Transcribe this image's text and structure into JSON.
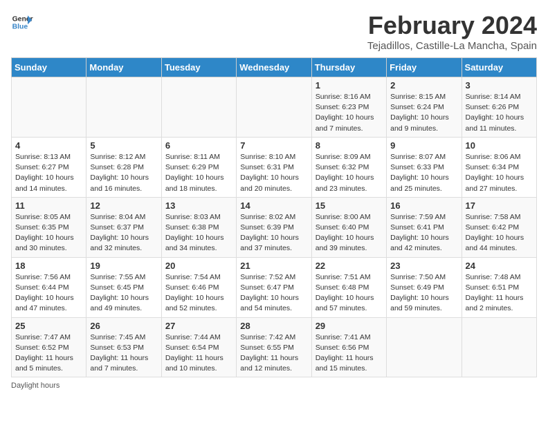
{
  "header": {
    "logo_line1": "General",
    "logo_line2": "Blue",
    "month": "February 2024",
    "location": "Tejadillos, Castille-La Mancha, Spain"
  },
  "columns": [
    "Sunday",
    "Monday",
    "Tuesday",
    "Wednesday",
    "Thursday",
    "Friday",
    "Saturday"
  ],
  "weeks": [
    [
      {
        "day": "",
        "info": ""
      },
      {
        "day": "",
        "info": ""
      },
      {
        "day": "",
        "info": ""
      },
      {
        "day": "",
        "info": ""
      },
      {
        "day": "1",
        "info": "Sunrise: 8:16 AM\nSunset: 6:23 PM\nDaylight: 10 hours\nand 7 minutes."
      },
      {
        "day": "2",
        "info": "Sunrise: 8:15 AM\nSunset: 6:24 PM\nDaylight: 10 hours\nand 9 minutes."
      },
      {
        "day": "3",
        "info": "Sunrise: 8:14 AM\nSunset: 6:26 PM\nDaylight: 10 hours\nand 11 minutes."
      }
    ],
    [
      {
        "day": "4",
        "info": "Sunrise: 8:13 AM\nSunset: 6:27 PM\nDaylight: 10 hours\nand 14 minutes."
      },
      {
        "day": "5",
        "info": "Sunrise: 8:12 AM\nSunset: 6:28 PM\nDaylight: 10 hours\nand 16 minutes."
      },
      {
        "day": "6",
        "info": "Sunrise: 8:11 AM\nSunset: 6:29 PM\nDaylight: 10 hours\nand 18 minutes."
      },
      {
        "day": "7",
        "info": "Sunrise: 8:10 AM\nSunset: 6:31 PM\nDaylight: 10 hours\nand 20 minutes."
      },
      {
        "day": "8",
        "info": "Sunrise: 8:09 AM\nSunset: 6:32 PM\nDaylight: 10 hours\nand 23 minutes."
      },
      {
        "day": "9",
        "info": "Sunrise: 8:07 AM\nSunset: 6:33 PM\nDaylight: 10 hours\nand 25 minutes."
      },
      {
        "day": "10",
        "info": "Sunrise: 8:06 AM\nSunset: 6:34 PM\nDaylight: 10 hours\nand 27 minutes."
      }
    ],
    [
      {
        "day": "11",
        "info": "Sunrise: 8:05 AM\nSunset: 6:35 PM\nDaylight: 10 hours\nand 30 minutes."
      },
      {
        "day": "12",
        "info": "Sunrise: 8:04 AM\nSunset: 6:37 PM\nDaylight: 10 hours\nand 32 minutes."
      },
      {
        "day": "13",
        "info": "Sunrise: 8:03 AM\nSunset: 6:38 PM\nDaylight: 10 hours\nand 34 minutes."
      },
      {
        "day": "14",
        "info": "Sunrise: 8:02 AM\nSunset: 6:39 PM\nDaylight: 10 hours\nand 37 minutes."
      },
      {
        "day": "15",
        "info": "Sunrise: 8:00 AM\nSunset: 6:40 PM\nDaylight: 10 hours\nand 39 minutes."
      },
      {
        "day": "16",
        "info": "Sunrise: 7:59 AM\nSunset: 6:41 PM\nDaylight: 10 hours\nand 42 minutes."
      },
      {
        "day": "17",
        "info": "Sunrise: 7:58 AM\nSunset: 6:42 PM\nDaylight: 10 hours\nand 44 minutes."
      }
    ],
    [
      {
        "day": "18",
        "info": "Sunrise: 7:56 AM\nSunset: 6:44 PM\nDaylight: 10 hours\nand 47 minutes."
      },
      {
        "day": "19",
        "info": "Sunrise: 7:55 AM\nSunset: 6:45 PM\nDaylight: 10 hours\nand 49 minutes."
      },
      {
        "day": "20",
        "info": "Sunrise: 7:54 AM\nSunset: 6:46 PM\nDaylight: 10 hours\nand 52 minutes."
      },
      {
        "day": "21",
        "info": "Sunrise: 7:52 AM\nSunset: 6:47 PM\nDaylight: 10 hours\nand 54 minutes."
      },
      {
        "day": "22",
        "info": "Sunrise: 7:51 AM\nSunset: 6:48 PM\nDaylight: 10 hours\nand 57 minutes."
      },
      {
        "day": "23",
        "info": "Sunrise: 7:50 AM\nSunset: 6:49 PM\nDaylight: 10 hours\nand 59 minutes."
      },
      {
        "day": "24",
        "info": "Sunrise: 7:48 AM\nSunset: 6:51 PM\nDaylight: 11 hours\nand 2 minutes."
      }
    ],
    [
      {
        "day": "25",
        "info": "Sunrise: 7:47 AM\nSunset: 6:52 PM\nDaylight: 11 hours\nand 5 minutes."
      },
      {
        "day": "26",
        "info": "Sunrise: 7:45 AM\nSunset: 6:53 PM\nDaylight: 11 hours\nand 7 minutes."
      },
      {
        "day": "27",
        "info": "Sunrise: 7:44 AM\nSunset: 6:54 PM\nDaylight: 11 hours\nand 10 minutes."
      },
      {
        "day": "28",
        "info": "Sunrise: 7:42 AM\nSunset: 6:55 PM\nDaylight: 11 hours\nand 12 minutes."
      },
      {
        "day": "29",
        "info": "Sunrise: 7:41 AM\nSunset: 6:56 PM\nDaylight: 11 hours\nand 15 minutes."
      },
      {
        "day": "",
        "info": ""
      },
      {
        "day": "",
        "info": ""
      }
    ]
  ],
  "footer": {
    "label": "Daylight hours"
  }
}
